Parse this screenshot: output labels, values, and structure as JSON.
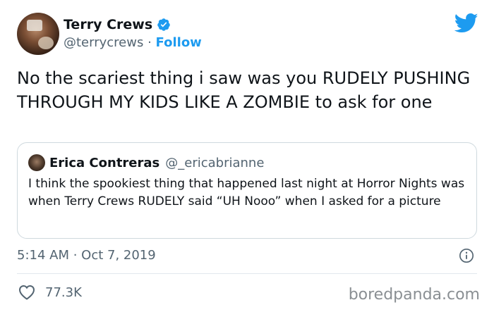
{
  "author": {
    "display_name": "Terry Crews",
    "handle": "@terrycrews",
    "separator": "·",
    "follow_label": "Follow"
  },
  "tweet": {
    "text": "No the scariest thing i saw was you RUDELY PUSHING THROUGH MY KIDS LIKE A ZOMBIE to ask for one",
    "timestamp": "5:14 AM · Oct 7, 2019"
  },
  "quoted_tweet": {
    "display_name": "Erica Contreras",
    "handle": "@_ericabrianne",
    "text": "I think the spookiest thing that happened last night at Horror Nights was when Terry Crews RUDELY said “UH Nooo” when I asked for a picture"
  },
  "engagement": {
    "like_count": "77.3K"
  },
  "watermark": "boredpanda.com",
  "icons": {
    "verified": "verified-badge-icon",
    "brand": "twitter-bird-icon",
    "info": "info-icon",
    "like": "heart-icon"
  },
  "colors": {
    "accent": "#1d9bf0",
    "text": "#0f1419",
    "secondary": "#536471",
    "border": "#cfd9de"
  }
}
